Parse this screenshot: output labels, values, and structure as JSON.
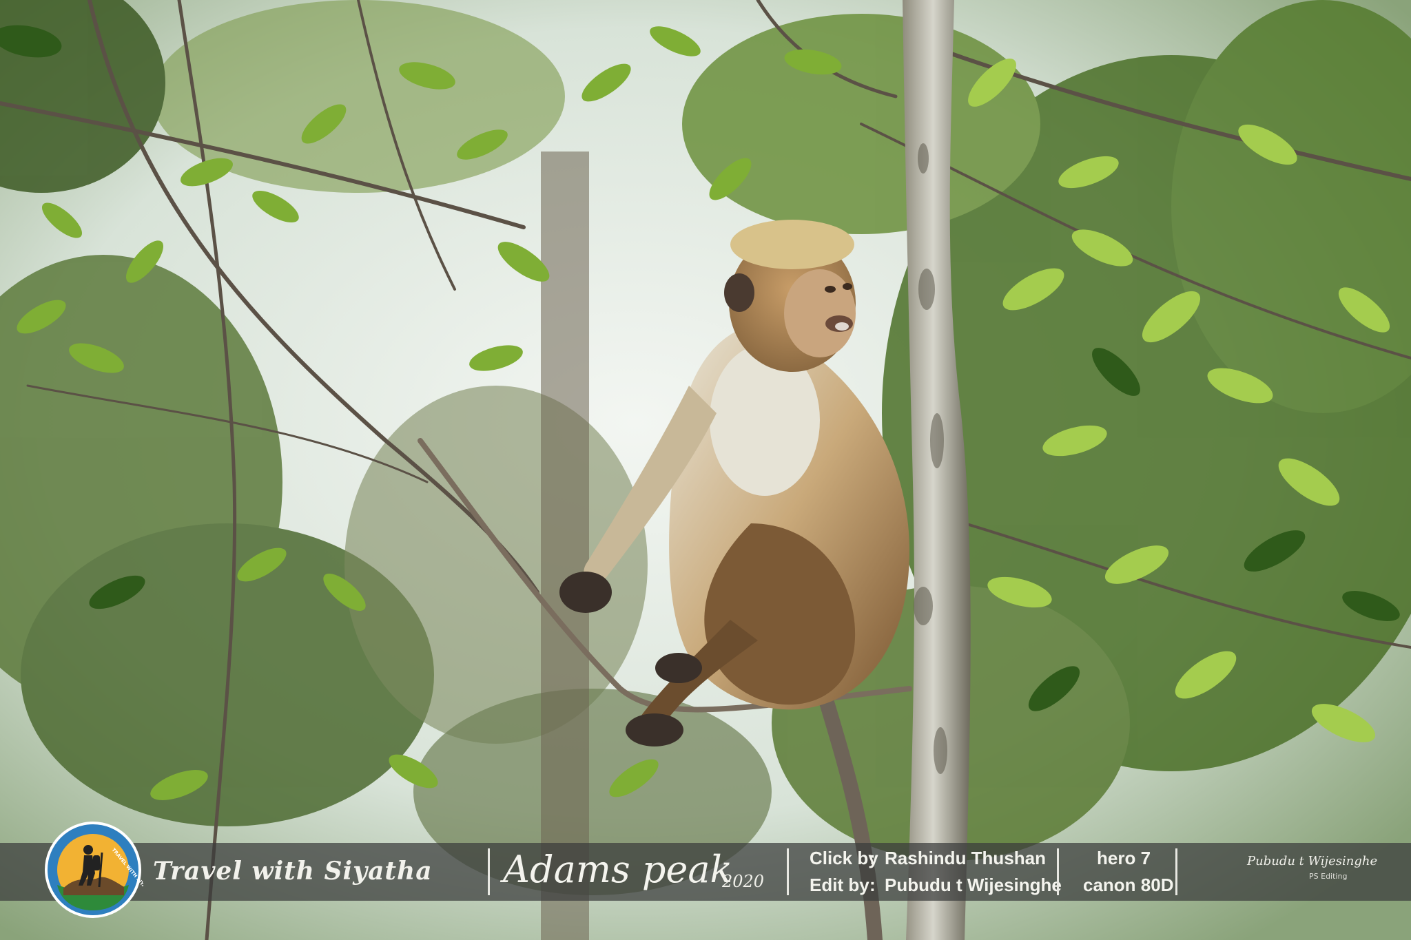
{
  "watermark": {
    "brand": "Travel with Siyatha",
    "logo_ring_text": "TRAVEL WITH SIYATHA",
    "location": "Adams peak",
    "year": "2020",
    "click_label": "Click by",
    "click_value": "Rashindu Thushan",
    "edit_label": "Edit by",
    "edit_value": "Pubudu t Wijesinghe",
    "colon": ":",
    "camera_1": "hero 7",
    "camera_2": "canon 80D",
    "signature": "Pubudu t Wijesinghe",
    "signature_sub": "PS Editing"
  },
  "colors": {
    "sky": "#e3ebe6",
    "foliage": "#5f8a2e",
    "foliage_bright": "#9cc44a",
    "trunk": "#b7b6a8",
    "monkey_fur": "#b7925e",
    "monkey_chest": "#e2dfd2",
    "banner": "#3a3c3c"
  }
}
